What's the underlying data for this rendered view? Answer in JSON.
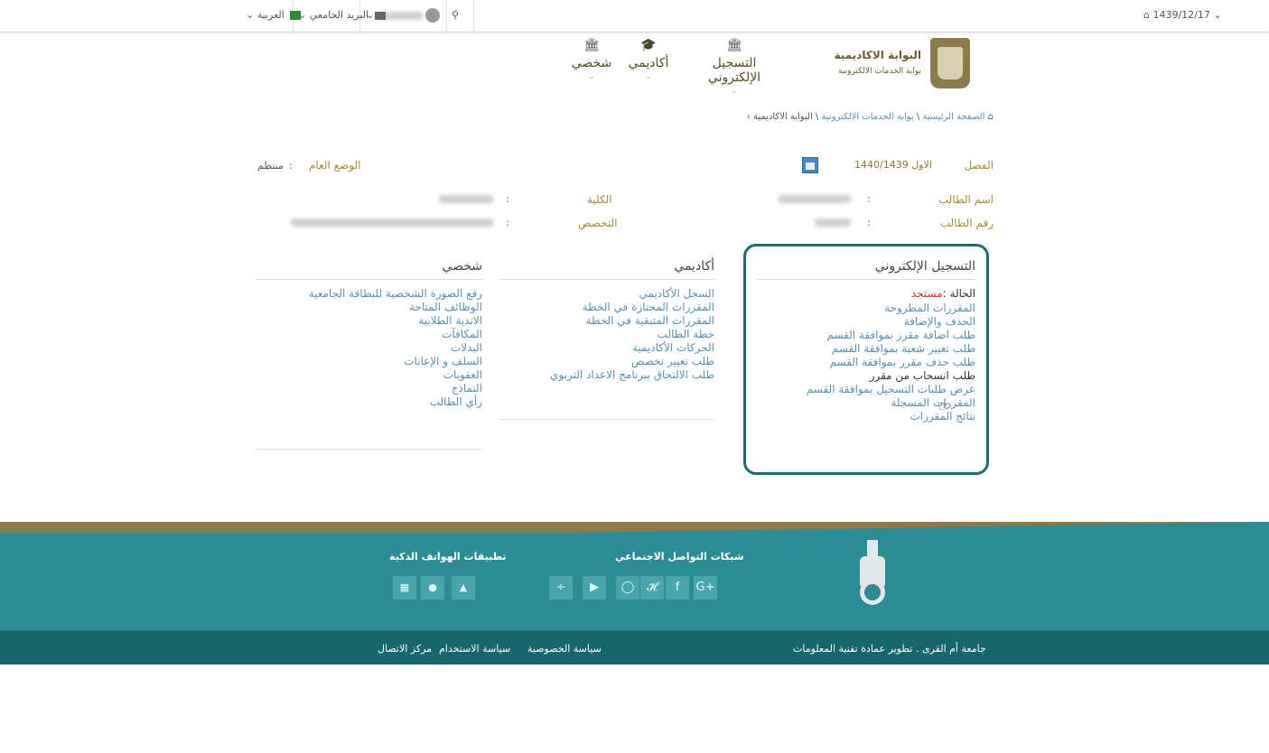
{
  "topbar": {
    "date_label": "1439/12/17",
    "search_icon": "search-icon",
    "user_name": "████████",
    "mail_label": "البريد الجامعي",
    "language_label": "العربية"
  },
  "header": {
    "brand_title": "البوابة الاكاديمية",
    "brand_subtitle": "بوابة الخدمات الالكترونية",
    "nav": [
      {
        "label": "التسجيل الإلكتروني",
        "icon": "bank-icon"
      },
      {
        "label": "أكاديمي",
        "icon": "graduation-cap-icon"
      },
      {
        "label": "شخصي",
        "icon": "bank-icon"
      }
    ]
  },
  "breadcrumb": {
    "home": "الصفحة الرئيسية",
    "level2": "بوابة الخدمات الالكترونية",
    "level3": "البوابة الاكاديمية"
  },
  "info": {
    "semester_label": "الفصل",
    "semester_value": "الاول 1440/1439",
    "general_status_label": "الوضع العام",
    "general_status_value": "منتظم",
    "student_name_label": "اسم الطالب",
    "student_id_label": "رقم الطالب",
    "college_label": "الكلية",
    "major_label": "التخصص"
  },
  "panels": {
    "registration": {
      "title": "التسجيل الإلكتروني",
      "status_label": "الحالة :",
      "status_value": "مستجد",
      "items": [
        "المقررات المطروحة",
        "الحذف والإضافة",
        "طلب اضافة مقرر بموافقة القسم",
        "طلب تغيير شعبة بموافقة القسم",
        "طلب حذف مقرر بموافقة القسم",
        "طلب انسحاب من مقرر",
        "عرض طلبات التسجيل بموافقة القسم",
        "المقررات المسجلة",
        "نتائج المقررات"
      ]
    },
    "academic": {
      "title": "أكاديمي",
      "items": [
        "السجل الأكاديمي",
        "المقررات المجتازة في الخطة",
        "المقررات المتبقية في الخطة",
        "خطة الطالب",
        "الحركات الأكاديمية",
        "طلب تغيير تخصص",
        "طلب الالتحاق ببرنامج الاعداد التربوي"
      ]
    },
    "personal": {
      "title": "شخصي",
      "items": [
        "رفع الصورة الشخصية للبطاقة الجامعية",
        "الوظائف المتاحة",
        "الاندية الطلابية",
        "المكافآت",
        "البدلات",
        "السلف و الإعانات",
        "العقوبات",
        "النماذج",
        "رأي الطالب"
      ]
    }
  },
  "footer": {
    "social_title": "شبكات التواصل الاجتماعي",
    "apps_title": "تطبيقات الهواتف الذكية",
    "copyright": "جامعة أم القرى . تطوير عمادة تقنية المعلومات",
    "links": [
      "سياسة الخصوصية",
      "سياسة الاستخدام",
      "مركز الاتصال"
    ],
    "social_icons": [
      "rss-icon",
      "youtube-icon",
      "instagram-icon",
      "twitter-icon",
      "facebook-icon",
      "google-plus-icon"
    ],
    "app_icons": [
      "windows-icon",
      "apple-icon",
      "android-icon"
    ],
    "colors": {
      "teal": "#2d8b93",
      "dark_teal": "#17666e",
      "gold": "#8a7a4c"
    }
  }
}
